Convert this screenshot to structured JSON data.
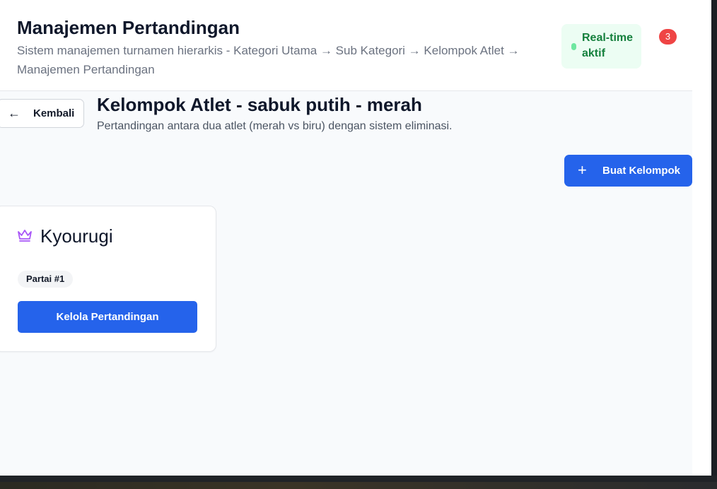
{
  "header": {
    "title": "Manajemen Pertandingan",
    "subtitle": "Sistem manajemen turnamen hierarkis - Kategori Utama → Sub Kategori → Kelompok Atlet → Manajemen Pertandingan",
    "realtime_label": "Real-time aktif",
    "notification_count": "3"
  },
  "page": {
    "back_label": "Kembali",
    "title": "Kelompok Atlet - sabuk putih - merah",
    "subtitle": "Pertandingan antara dua atlet (merah vs biru) dengan sistem eliminasi.",
    "create_button_label": "Buat Kelompok"
  },
  "cards": [
    {
      "icon": "crown-icon",
      "title": "Kyourugi",
      "badge": "Partai #1",
      "action_label": "Kelola Pertandingan"
    }
  ],
  "colors": {
    "primary": "#2563eb",
    "success_bg": "#ecfdf3",
    "success_text": "#15803d",
    "danger": "#ef4444",
    "crown": "#a855f7"
  }
}
